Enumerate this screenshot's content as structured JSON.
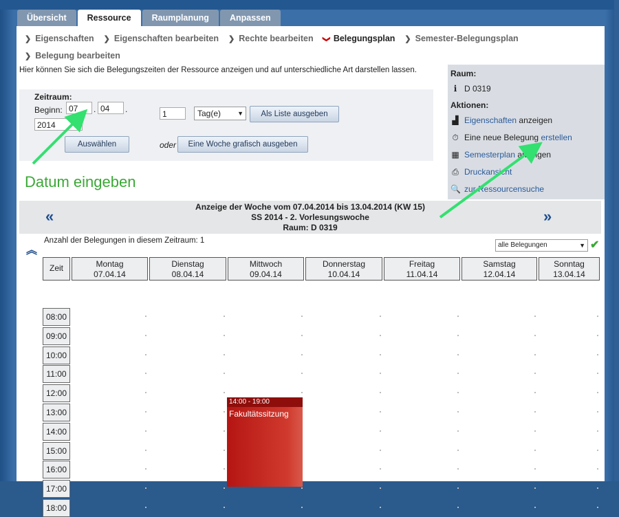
{
  "tabs": [
    "Übersicht",
    "Ressource",
    "Raumplanung",
    "Anpassen"
  ],
  "active_tab": 1,
  "subnav": [
    {
      "label": "Eigenschaften",
      "active": false
    },
    {
      "label": "Eigenschaften bearbeiten",
      "active": false
    },
    {
      "label": "Rechte bearbeiten",
      "active": false
    },
    {
      "label": "Belegungsplan",
      "active": true
    },
    {
      "label": "Semester-Belegungsplan",
      "active": false
    },
    {
      "label": "Belegung bearbeiten",
      "active": false
    }
  ],
  "intro": "Hier können Sie sich die Belegungszeiten der Ressource anzeigen und auf unterschiedliche Art darstellen lassen.",
  "form": {
    "zeitraum_label": "Zeitraum:",
    "beginn_label": "Beginn:",
    "day": "07",
    "month": "04",
    "year": "2014",
    "dot1": ".",
    "dot2": ".",
    "count": "1",
    "unit": "Tag(e)",
    "btn_liste": "Als Liste ausgeben",
    "btn_auswaehlen": "Auswählen",
    "oder": "oder",
    "btn_woche": "Eine Woche grafisch ausgeben"
  },
  "sidebar": {
    "raum_heading": "Raum:",
    "raum_value": "D 0319",
    "aktionen_heading": "Aktionen:",
    "actions": [
      {
        "link": "Eigenschaften",
        "text": " anzeigen",
        "icon": "properties-icon",
        "glyph": "▟"
      },
      {
        "text": "Eine neue Belegung ",
        "link": "erstellen",
        "icon": "clock-add-icon",
        "glyph": "⏱"
      },
      {
        "link": "Semesterplan",
        "text": " anzeigen",
        "icon": "calendar-icon",
        "glyph": "▦"
      },
      {
        "link": "Druckansicht",
        "text": "",
        "icon": "printer-icon",
        "glyph": "⎙"
      },
      {
        "link": "zur Ressourcensuche",
        "text": "",
        "icon": "search-icon",
        "glyph": "🔍"
      }
    ]
  },
  "annotation": "Datum eingeben",
  "week": {
    "line1": "Anzeige der Woche vom 07.04.2014 bis 13.04.2014 (KW 15)",
    "line2": "SS 2014 - 2. Vorlesungswoche",
    "line3": "Raum: D 0319",
    "prev": "«",
    "next": "»"
  },
  "count_text": "Anzahl der Belegungen in diesem Zeitraum: 1",
  "filter": "alle Belegungen",
  "grid": {
    "zeit_label": "Zeit",
    "days": [
      {
        "name": "Montag",
        "date": "07.04.14"
      },
      {
        "name": "Dienstag",
        "date": "08.04.14"
      },
      {
        "name": "Mittwoch",
        "date": "09.04.14"
      },
      {
        "name": "Donnerstag",
        "date": "10.04.14"
      },
      {
        "name": "Freitag",
        "date": "11.04.14"
      },
      {
        "name": "Samstag",
        "date": "12.04.14"
      },
      {
        "name": "Sonntag",
        "date": "13.04.14"
      }
    ],
    "times": [
      "08:00",
      "09:00",
      "10:00",
      "11:00",
      "12:00",
      "13:00",
      "14:00",
      "15:00",
      "16:00",
      "17:00",
      "18:00"
    ],
    "event": {
      "time": "14:00 - 19:00",
      "title": "Fakultätssitzung",
      "day": "Mittwoch"
    }
  },
  "colors": {
    "accent": "#2a5a9a",
    "event": "#c0201a",
    "annotation": "#3aa935"
  }
}
